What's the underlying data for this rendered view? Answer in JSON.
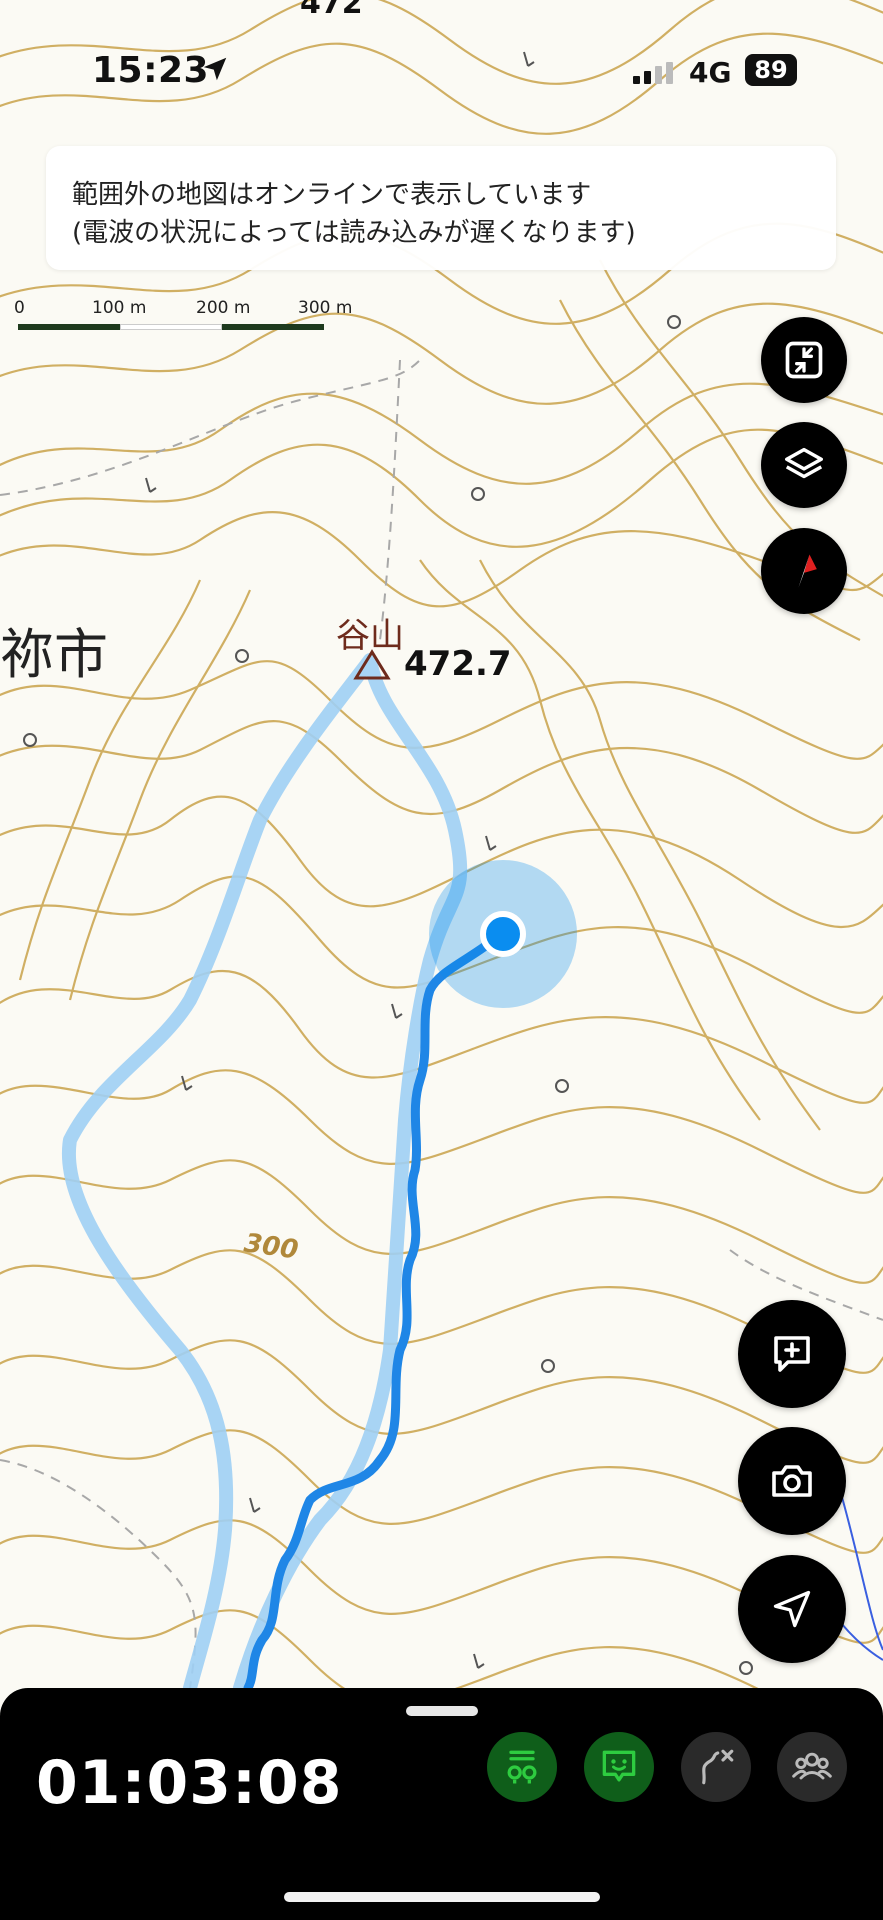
{
  "status_bar": {
    "time": "15:23",
    "network": "4G",
    "battery": "89"
  },
  "notice": {
    "line1": "範囲外の地図はオンラインで表示しています",
    "line2": "(電波の状況によっては読み込みが遅くなります)"
  },
  "scale": {
    "labels": [
      "0",
      "100 m",
      "200 m",
      "300 m"
    ]
  },
  "map_labels": {
    "city": "祢市",
    "peak_name": "谷山",
    "peak_elevation": "472.7",
    "contour": "300",
    "top_partial": "472"
  },
  "controls": {
    "right_icons": [
      "fullscreen-exit-icon",
      "layers-icon",
      "compass-icon"
    ],
    "action_icons": [
      "add-note-icon",
      "camera-icon",
      "navigation-icon"
    ]
  },
  "bottom_panel": {
    "elapsed_time": "01:03:08",
    "icons": [
      "checkpoint-icon",
      "chat-face-icon",
      "route-off-icon",
      "group-icon"
    ]
  },
  "colors": {
    "contour": "#c9a24a",
    "track_recorded": "#1f86e6",
    "track_planned": "#9ecff4",
    "location_dot": "#0a8df0",
    "active_green": "#2ecc40"
  }
}
